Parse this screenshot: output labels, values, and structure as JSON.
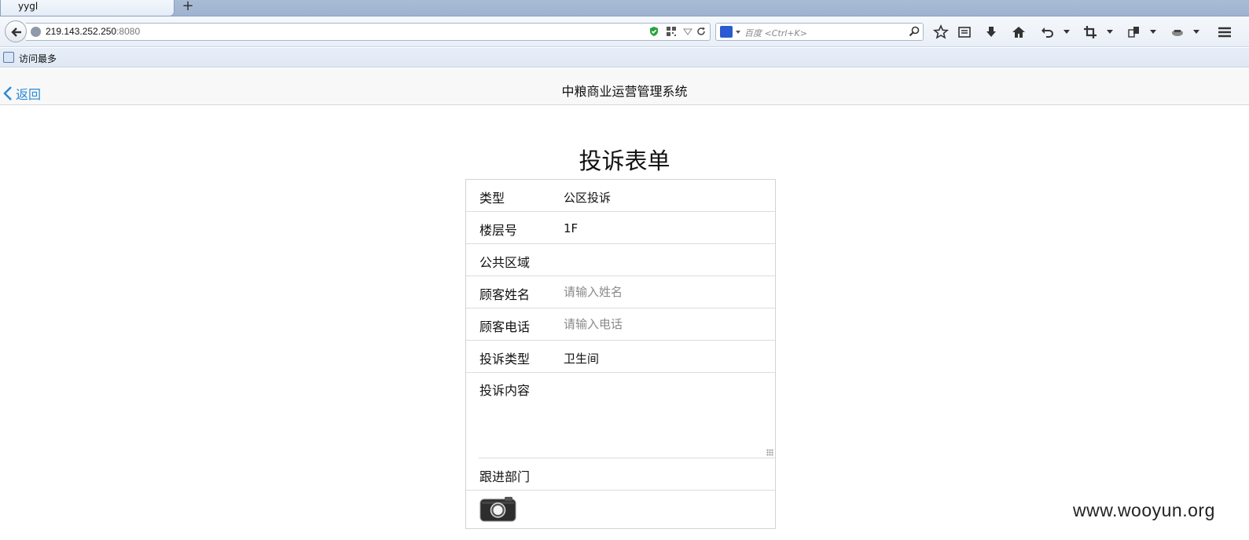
{
  "browser": {
    "tab": {
      "title": "yygl",
      "new_tab_label": "+"
    },
    "url": {
      "host": "219.143.252.250",
      "port": ":8080"
    },
    "search": {
      "placeholder": "百度 <Ctrl+K>"
    },
    "bookmarks": [
      {
        "label": "访问最多"
      }
    ],
    "toolbar_icons": [
      "star-icon",
      "reading-list-icon",
      "download-icon",
      "home-icon",
      "undo-icon",
      "crop-icon",
      "page-icon",
      "extension-icon",
      "menu-icon"
    ]
  },
  "header": {
    "back_label": "返回",
    "title": "中粮商业运营管理系统"
  },
  "form": {
    "title": "投诉表单",
    "rows": [
      {
        "label": "类型",
        "value": "公区投诉"
      },
      {
        "label": "楼层号",
        "value": "1F"
      },
      {
        "label": "公共区域",
        "value": ""
      },
      {
        "label": "顾客姓名",
        "placeholder": "请输入姓名"
      },
      {
        "label": "顾客电话",
        "placeholder": "请输入电话"
      },
      {
        "label": "投诉类型",
        "value": "卫生间"
      },
      {
        "label": "投诉内容",
        "value": ""
      },
      {
        "label": "跟进部门",
        "value": ""
      }
    ],
    "camera_icon": "camera-icon"
  },
  "watermark": "www.wooyun.org",
  "colors": {
    "link": "#2b8ad3",
    "tab_strip": "#a9bcd6",
    "header_bg": "#f8f8f8"
  }
}
